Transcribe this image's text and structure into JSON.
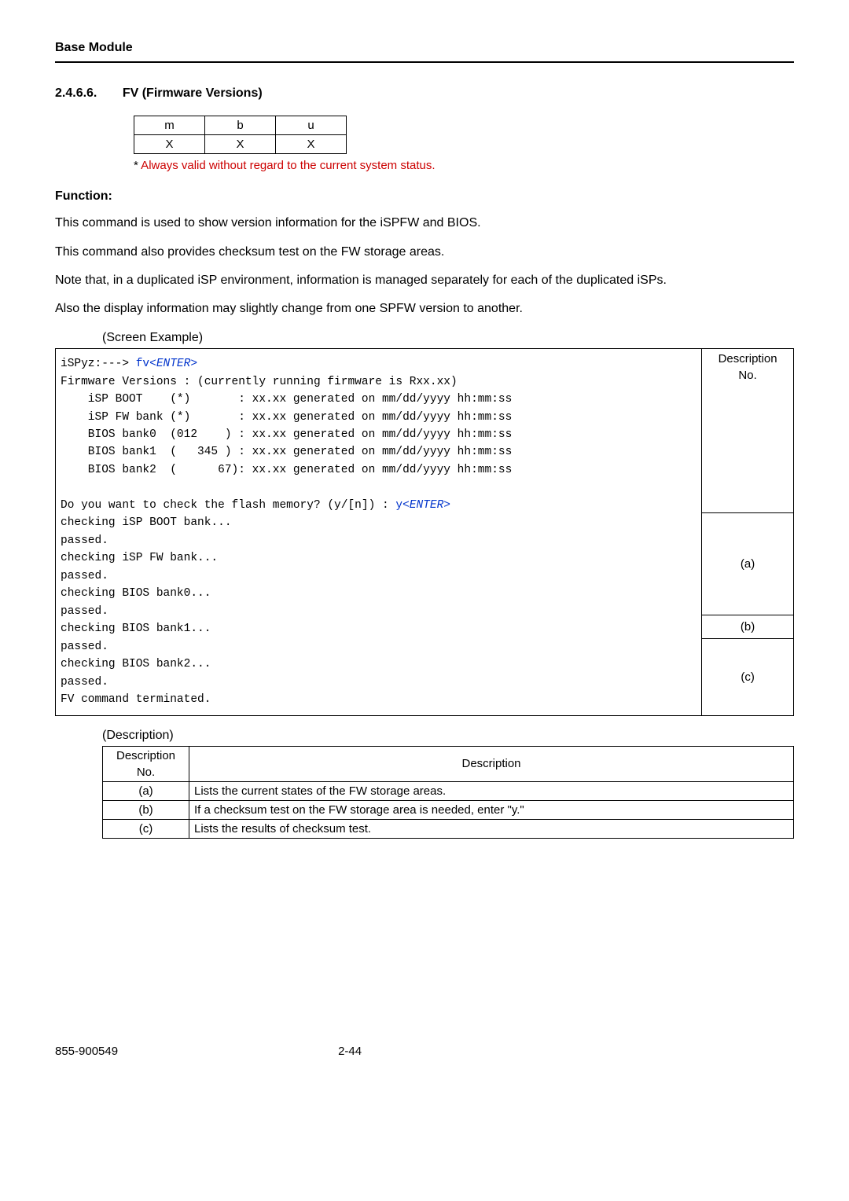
{
  "header": {
    "module": "Base Module"
  },
  "section": {
    "number": "2.4.6.6.",
    "title": "FV (Firmware Versions)"
  },
  "perm_table": {
    "headers": [
      "m",
      "b",
      "u"
    ],
    "values": [
      "X",
      "X",
      "X"
    ],
    "note_asterisk": "*",
    "note_text": " Always valid without regard to the current system status."
  },
  "function": {
    "heading": "Function:",
    "p1": "This command is used to show version information for the iSPFW and BIOS.",
    "p2": "This command also provides checksum test on the FW storage areas.",
    "p3": "Note that, in a duplicated iSP environment, information is managed separately for each of the duplicated iSPs.",
    "p4": "Also the display information may slightly change from one SPFW version to another."
  },
  "screen_example": {
    "label": "(Screen Example)",
    "col_head": "Description\nNo.",
    "prompt_prefix": "iSPyz:---> ",
    "prompt_cmd": "fv",
    "prompt_enter": "<ENTER>",
    "l1": "Firmware Versions : (currently running firmware is Rxx.xx)",
    "l2": "    iSP BOOT    (*)       : xx.xx generated on mm/dd/yyyy hh:mm:ss",
    "l3": "    iSP FW bank (*)       : xx.xx generated on mm/dd/yyyy hh:mm:ss",
    "l4": "    BIOS bank0  (012    ) : xx.xx generated on mm/dd/yyyy hh:mm:ss",
    "l5": "    BIOS bank1  (   345 ) : xx.xx generated on mm/dd/yyyy hh:mm:ss",
    "l6": "    BIOS bank2  (      67): xx.xx generated on mm/dd/yyyy hh:mm:ss",
    "desc_a": "(a)",
    "q_prefix": "Do you want to check the flash memory? (y/[n]) : ",
    "q_y": "y",
    "q_enter": "<ENTER>",
    "desc_b": "(b)",
    "c1": "checking iSP BOOT bank...",
    "c2": "passed.",
    "c3": "checking iSP FW bank...",
    "c4": "passed.",
    "c5": "checking BIOS bank0...",
    "c6": "passed.",
    "desc_c": "(c)",
    "c7": "checking BIOS bank1...",
    "c8": "passed.",
    "c9": "checking BIOS bank2...",
    "c10": "passed.",
    "c11": "FV command terminated."
  },
  "description": {
    "label": "(Description)",
    "col1": "Description\nNo.",
    "col2": "Description",
    "rows": [
      {
        "no": "(a)",
        "text": "Lists the current states of the FW storage areas."
      },
      {
        "no": "(b)",
        "text": "If a checksum test on the FW storage area is needed, enter \"y.\""
      },
      {
        "no": "(c)",
        "text": "Lists the results of checksum test."
      }
    ]
  },
  "footer": {
    "docnum": "855-900549",
    "pagenum": "2-44"
  }
}
